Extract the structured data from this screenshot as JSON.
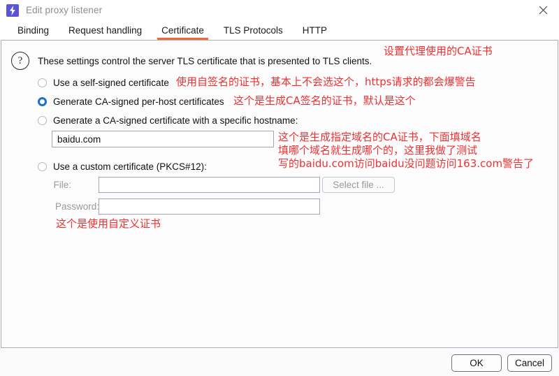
{
  "window": {
    "title": "Edit proxy listener",
    "icon": "burp-lightning-icon",
    "close_icon": "close-icon"
  },
  "tabs": [
    {
      "label": "Binding",
      "active": false
    },
    {
      "label": "Request handling",
      "active": false
    },
    {
      "label": "Certificate",
      "active": true
    },
    {
      "label": "TLS Protocols",
      "active": false
    },
    {
      "label": "HTTP",
      "active": false
    }
  ],
  "panel": {
    "help_icon": "question-mark-icon",
    "help_text": "These settings control the server TLS certificate that is presented to TLS clients.",
    "options": [
      {
        "label": "Use a self-signed certificate",
        "checked": false
      },
      {
        "label": "Generate CA-signed per-host certificates",
        "checked": true
      },
      {
        "label": "Generate a CA-signed certificate with a specific hostname:",
        "checked": false
      },
      {
        "label": "Use a custom certificate (PKCS#12):",
        "checked": false
      }
    ],
    "hostname_input": {
      "value": "baidu.com",
      "placeholder": ""
    },
    "file_label": "File:",
    "file_input": {
      "value": "",
      "placeholder": ""
    },
    "select_file_button": "Select file ...",
    "password_label": "Password:",
    "password_input": {
      "value": "",
      "placeholder": ""
    }
  },
  "annotations": {
    "top": "设置代理使用的CA证书",
    "self_signed": "使用自签名的证书，基本上不会选这个，https请求的都会爆警告",
    "ca_signed": "这个是生成CA签名的证书，默认是这个",
    "hostname_1": "这个是生成指定域名的CA证书，下面填域名",
    "hostname_2": "填哪个域名就生成哪个的，这里我做了测试",
    "hostname_3": "写的baidu.com访问baidu没问题访问163.com警告了",
    "custom": "这个是使用自定义证书"
  },
  "footer": {
    "ok_label": "OK",
    "cancel_label": "Cancel"
  },
  "colors": {
    "accent_tab_underline": "#ef6a36",
    "radio_selected": "#1d6fc7",
    "annotation_red": "#f03030",
    "app_icon_bg": "#5b55d6"
  }
}
